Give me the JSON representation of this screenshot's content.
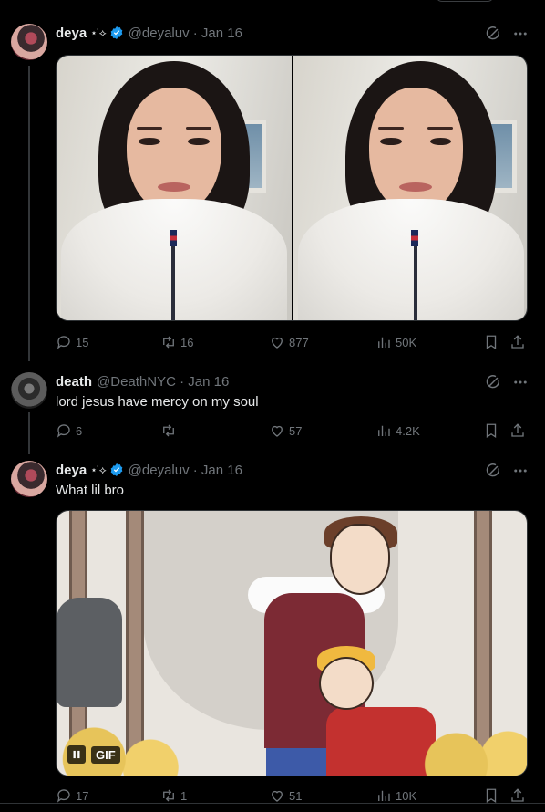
{
  "colors": {
    "background": "#000000",
    "text": "#e7e9ea",
    "muted": "#71767b",
    "verified": "#1d9bf0"
  },
  "tweets": [
    {
      "name": "deya",
      "name_deco": "⋆˙⟡",
      "handle_date": "@deyaluv · Jan 16",
      "text": "",
      "media_type": "photos",
      "avatar_icon": "avatar-deya",
      "stats": {
        "replies": "15",
        "retweets": "16",
        "likes": "877",
        "views": "50K"
      }
    },
    {
      "name": "death",
      "name_deco": "",
      "handle_date": "@DeathNYC · Jan 16",
      "text": "lord jesus have mercy on my soul",
      "media_type": "none",
      "avatar_icon": "avatar-death",
      "stats": {
        "replies": "6",
        "retweets": "",
        "likes": "57",
        "views": "4.2K"
      }
    },
    {
      "name": "deya",
      "name_deco": "⋆˙⟡",
      "handle_date": "@deyaluv · Jan 16",
      "text": "What lil bro",
      "media_type": "gif",
      "gif_label": "GIF",
      "avatar_icon": "avatar-deya",
      "stats": {
        "replies": "17",
        "retweets": "1",
        "likes": "51",
        "views": "10K"
      }
    }
  ]
}
